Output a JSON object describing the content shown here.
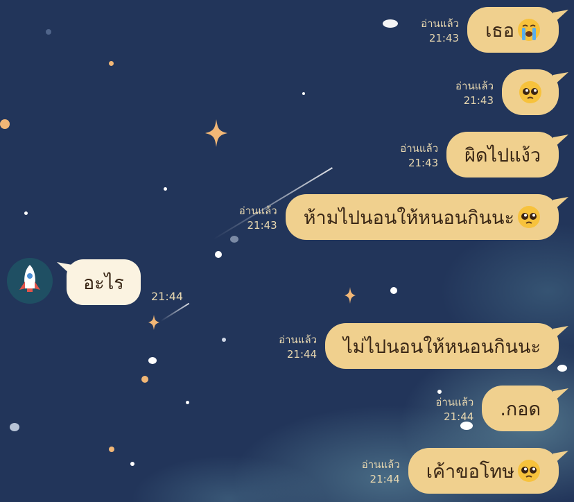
{
  "conversation": {
    "outgoing_top": [
      {
        "read": "อ่านแล้ว",
        "time": "21:43",
        "text": "เธอ",
        "emoji": "loudly-crying-face-icon"
      },
      {
        "read": "อ่านแล้ว",
        "time": "21:43",
        "text": "",
        "emoji": "pleading-face-icon"
      },
      {
        "read": "อ่านแล้ว",
        "time": "21:43",
        "text": "ผิดไปแง้ว",
        "emoji": ""
      },
      {
        "read": "อ่านแล้ว",
        "time": "21:43",
        "text": "ห้ามไปนอนให้หนอนกินนะ",
        "emoji": "pleading-face-icon"
      }
    ],
    "incoming": {
      "avatar_icon": "rocket-icon",
      "text": "อะไร",
      "time": "21:44"
    },
    "outgoing_bottom": [
      {
        "read": "อ่านแล้ว",
        "time": "21:44",
        "text": "ไม่ไปนอนให้หนอนกินนะ",
        "emoji": ""
      },
      {
        "read": "อ่านแล้ว",
        "time": "21:44",
        "text": ".กอด",
        "emoji": ""
      },
      {
        "read": "อ่านแล้ว",
        "time": "21:44",
        "text": "เค้าขอโทษ",
        "emoji": "pleading-face-icon"
      }
    ]
  },
  "colors": {
    "background": "#22355a",
    "outgoing_bubble": "#f0d08e",
    "incoming_bubble": "#fbf3e1",
    "meta_text": "#e7d7b0",
    "star": "#f2b776"
  }
}
